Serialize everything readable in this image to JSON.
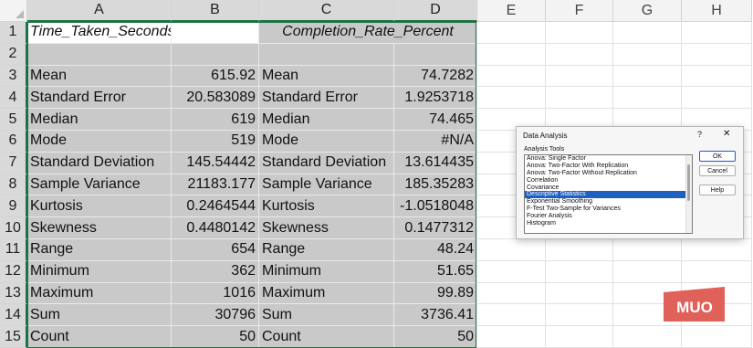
{
  "spreadsheet": {
    "columns": [
      "A",
      "B",
      "C",
      "D",
      "E",
      "F",
      "G",
      "H"
    ],
    "rows": [
      "1",
      "2",
      "3",
      "4",
      "5",
      "6",
      "7",
      "8",
      "9",
      "10",
      "11",
      "12",
      "13",
      "14",
      "15"
    ],
    "header_row": {
      "a": "Time_Taken_Seconds",
      "cd": "Completion_Rate_Percent"
    },
    "stats": [
      {
        "label": "Mean",
        "b": "615.92",
        "label2": "Mean",
        "d": "74.7282"
      },
      {
        "label": "Standard Error",
        "b": "20.583089",
        "label2": "Standard Error",
        "d": "1.9253718"
      },
      {
        "label": "Median",
        "b": "619",
        "label2": "Median",
        "d": "74.465"
      },
      {
        "label": "Mode",
        "b": "519",
        "label2": "Mode",
        "d": "#N/A"
      },
      {
        "label": "Standard Deviation",
        "b": "145.54442",
        "label2": "Standard Deviation",
        "d": "13.614435"
      },
      {
        "label": "Sample Variance",
        "b": "21183.177",
        "label2": "Sample Variance",
        "d": "185.35283"
      },
      {
        "label": "Kurtosis",
        "b": "0.2464544",
        "label2": "Kurtosis",
        "d": "-1.0518048"
      },
      {
        "label": "Skewness",
        "b": "0.4480142",
        "label2": "Skewness",
        "d": "0.1477312"
      },
      {
        "label": "Range",
        "b": "654",
        "label2": "Range",
        "d": "48.24"
      },
      {
        "label": "Minimum",
        "b": "362",
        "label2": "Minimum",
        "d": "51.65"
      },
      {
        "label": "Maximum",
        "b": "1016",
        "label2": "Maximum",
        "d": "99.89"
      },
      {
        "label": "Sum",
        "b": "30796",
        "label2": "Sum",
        "d": "3736.41"
      },
      {
        "label": "Count",
        "b": "50",
        "label2": "Count",
        "d": "50"
      }
    ],
    "selection_color": "#1e7145",
    "selected_fill": "#c9c9c9"
  },
  "dialog": {
    "title": "Data Analysis",
    "help": "?",
    "close": "✕",
    "tools_label": "Analysis Tools",
    "tools": [
      "Anova: Single Factor",
      "Anova: Two-Factor With Replication",
      "Anova: Two-Factor Without Replication",
      "Correlation",
      "Covariance",
      "Descriptive Statistics",
      "Exponential Smoothing",
      "F-Test Two-Sample for Variances",
      "Fourier Analysis",
      "Histogram"
    ],
    "selected_tool": "Descriptive Statistics",
    "buttons": {
      "ok": "OK",
      "cancel": "Cancel",
      "help": "Help"
    },
    "selection_color": "#1f5fbf"
  },
  "watermark": {
    "text": "MUO",
    "color": "#e0605a"
  }
}
